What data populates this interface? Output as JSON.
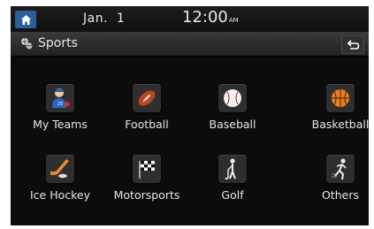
{
  "status_bar": {
    "date": "Jan.  1",
    "time": "12:00",
    "ampm": "AM"
  },
  "header": {
    "title": "Sports",
    "icon": "sports-balls-icon",
    "back_icon": "back-arrow-icon"
  },
  "items": [
    {
      "label": "My Teams",
      "icon": "player-star-icon"
    },
    {
      "label": "Football",
      "icon": "american-football-icon"
    },
    {
      "label": "Baseball",
      "icon": "baseball-icon"
    },
    {
      "label": "Basketball",
      "icon": "basketball-icon"
    },
    {
      "label": "Ice Hockey",
      "icon": "hockey-stick-puck-icon"
    },
    {
      "label": "Motorsports",
      "icon": "checkered-flag-icon"
    },
    {
      "label": "Golf",
      "icon": "golfer-icon"
    },
    {
      "label": "Others",
      "icon": "runner-icon"
    }
  ],
  "colors": {
    "accent": "#2c5f9a",
    "background": "#0c0c0c",
    "text": "#e6e6e6"
  }
}
